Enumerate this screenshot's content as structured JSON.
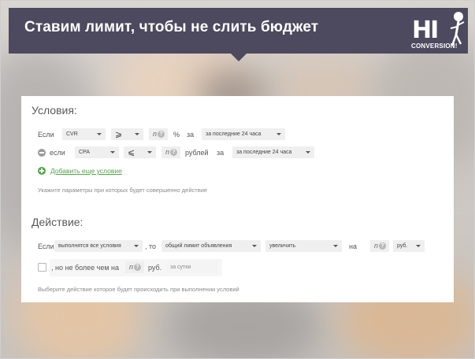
{
  "banner": {
    "title": "Ставим лимит, чтобы не слить бюджет",
    "logo_hi": "HI",
    "logo_conversion": "CONVERSION!"
  },
  "colors": {
    "banner_bg": "#4d4a5f",
    "accent_green": "#52a54a",
    "select_bg": "#efefef"
  },
  "conditions": {
    "title": "Условия:",
    "row1": {
      "if_label": "Если",
      "metric": "CVR",
      "operator": "⩾",
      "value_placeholder": "n",
      "unit": "%",
      "period_label": "за",
      "period": "за последние 24 часа"
    },
    "row2": {
      "if_label": "если",
      "metric": "CPA",
      "operator": "⩽",
      "value_placeholder": "n",
      "unit": "рублей",
      "period_label": "за",
      "period": "за последние 24 часа"
    },
    "add_link": "Добавить еще условие",
    "help": "Укажите параметры при которых будет совершенно действие"
  },
  "action": {
    "title": "Действие:",
    "if_label": "Если",
    "mode": "выполнятся все условия",
    "comma_then": ", то",
    "target": "общий лимит объявления",
    "verb": "увеличить",
    "by_label": "на",
    "value_placeholder": "n",
    "currency": "руб.",
    "cap_label": ", но не более чем на",
    "cap_placeholder": "n",
    "cap_unit": "руб.",
    "cap_period": "за сутки",
    "help": "Выберите действие которое будет происходить при выполнении условий"
  }
}
